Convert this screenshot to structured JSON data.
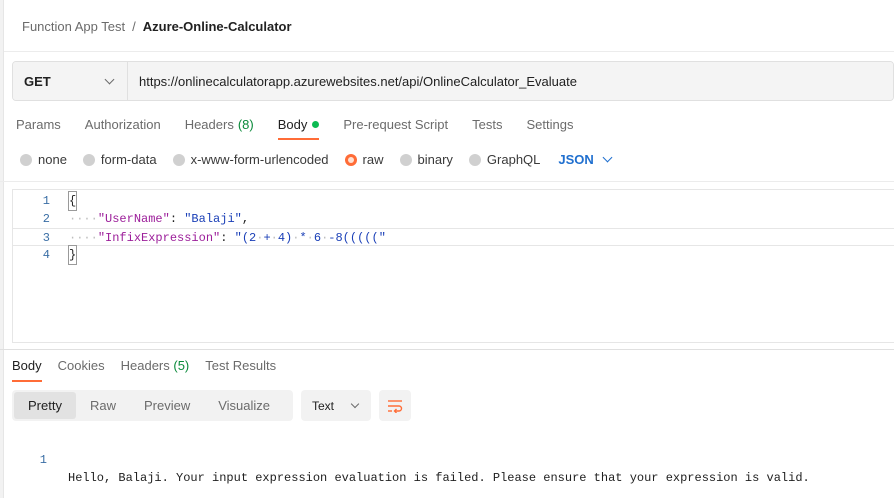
{
  "breadcrumb": {
    "parent": "Function App Test",
    "separator": "/",
    "current": "Azure-Online-Calculator"
  },
  "request": {
    "method": "GET",
    "url": "https://onlinecalculatorapp.azurewebsites.net/api/OnlineCalculator_Evaluate"
  },
  "request_tabs": [
    {
      "label": "Params"
    },
    {
      "label": "Authorization"
    },
    {
      "label": "Headers",
      "count": "(8)"
    },
    {
      "label": "Body",
      "active": true
    },
    {
      "label": "Pre-request Script"
    },
    {
      "label": "Tests"
    },
    {
      "label": "Settings"
    }
  ],
  "body_types": [
    {
      "label": "none"
    },
    {
      "label": "form-data"
    },
    {
      "label": "x-www-form-urlencoded"
    },
    {
      "label": "raw",
      "selected": true
    },
    {
      "label": "binary"
    },
    {
      "label": "GraphQL"
    }
  ],
  "body_format": "JSON",
  "editor": {
    "line_numbers": [
      "1",
      "2",
      "3",
      "4"
    ],
    "lines": [
      "{",
      "····\"UserName\": \"Balaji\",",
      "····\"InfixExpression\": \"(2·+·4)·*·6·-8(((((\"",
      "}"
    ]
  },
  "response_tabs": [
    {
      "label": "Body",
      "active": true
    },
    {
      "label": "Cookies"
    },
    {
      "label": "Headers",
      "count": "(5)"
    },
    {
      "label": "Test Results"
    }
  ],
  "view_modes": [
    {
      "label": "Pretty",
      "active": true
    },
    {
      "label": "Raw"
    },
    {
      "label": "Preview"
    },
    {
      "label": "Visualize"
    }
  ],
  "response_format": "Text",
  "response_body": {
    "line_number": "1",
    "text": "Hello, Balaji. Your input expression evaluation is failed. Please ensure that your expression is valid."
  },
  "icons": {
    "wrap": "wrap-lines-icon",
    "dropdown": "chevron-down-icon",
    "body_indicator": "green-dot-icon"
  },
  "colors": {
    "accent": "#ff6c37",
    "link": "#1f6fcf",
    "count": "#0a8a3a",
    "indicator": "#0cbb52"
  }
}
